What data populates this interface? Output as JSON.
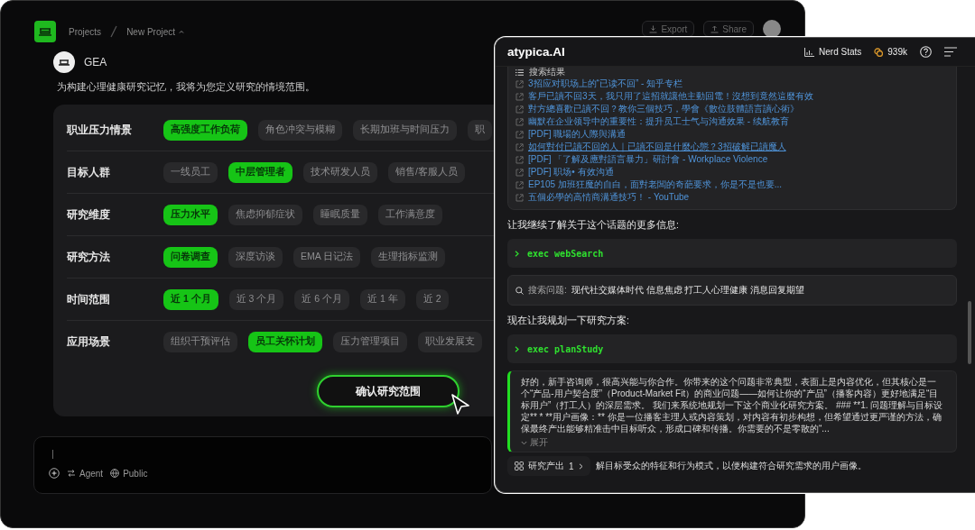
{
  "left_window": {
    "breadcrumb": [
      "Projects",
      "New Project"
    ],
    "header_buttons": [
      {
        "kind": "export",
        "label": "Export"
      },
      {
        "kind": "share",
        "label": "Share"
      }
    ],
    "assistant": {
      "name": "GEA",
      "message": "为构建心理健康研究记忆，我将为您定义研究的情境范围。"
    },
    "scope_rows": [
      {
        "label": "职业压力情景",
        "options": [
          {
            "label": "高强度工作负荷",
            "selected": true
          },
          {
            "label": "角色冲突与模糊",
            "selected": false
          },
          {
            "label": "长期加班与时间压力",
            "selected": false
          },
          {
            "label": "职",
            "selected": false
          }
        ]
      },
      {
        "label": "目标人群",
        "options": [
          {
            "label": "一线员工",
            "selected": false
          },
          {
            "label": "中层管理者",
            "selected": true
          },
          {
            "label": "技术研发人员",
            "selected": false
          },
          {
            "label": "销售/客服人员",
            "selected": false
          }
        ]
      },
      {
        "label": "研究维度",
        "options": [
          {
            "label": "压力水平",
            "selected": true
          },
          {
            "label": "焦虑抑郁症状",
            "selected": false
          },
          {
            "label": "睡眠质量",
            "selected": false
          },
          {
            "label": "工作满意度",
            "selected": false
          }
        ]
      },
      {
        "label": "研究方法",
        "options": [
          {
            "label": "问卷调查",
            "selected": true
          },
          {
            "label": "深度访谈",
            "selected": false
          },
          {
            "label": "EMA 日记法",
            "selected": false
          },
          {
            "label": "生理指标监测",
            "selected": false
          }
        ]
      },
      {
        "label": "时间范围",
        "options": [
          {
            "label": "近 1 个月",
            "selected": true
          },
          {
            "label": "近 3 个月",
            "selected": false
          },
          {
            "label": "近 6 个月",
            "selected": false
          },
          {
            "label": "近 1 年",
            "selected": false
          },
          {
            "label": "近 2",
            "selected": false
          }
        ]
      },
      {
        "label": "应用场景",
        "options": [
          {
            "label": "组织干预评估",
            "selected": false
          },
          {
            "label": "员工关怀计划",
            "selected": true
          },
          {
            "label": "压力管理项目",
            "selected": false
          },
          {
            "label": "职业发展支",
            "selected": false
          }
        ]
      }
    ],
    "confirm_button": "确认研究范围",
    "composer": {
      "tools": [
        {
          "kind": "agent",
          "label": "Agent"
        },
        {
          "kind": "public",
          "label": "Public"
        }
      ]
    }
  },
  "right_window": {
    "brand": "atypica.AI",
    "nerd_stats": "Nerd Stats",
    "credits": "939k",
    "search_results": {
      "title": "搜索结果",
      "links": [
        {
          "text": "3招应对职场上的“已读不回” - 知乎专栏",
          "hovered": false
        },
        {
          "text": "客戶已讀不回3天，我只用了這招就讓他主動回電！沒想到竟然這麼有效",
          "hovered": false
        },
        {
          "text": "對方總喜歡已讀不回？教你三個技巧，學會《數位肢體語言讀心術》",
          "hovered": false
        },
        {
          "text": "幽默在企业领导中的重要性：提升员工士气与沟通效果 - 续航教育",
          "hovered": false
        },
        {
          "text": "[PDF] 職場的人際與溝通",
          "hovered": false
        },
        {
          "text": "如何對付已讀不回的人｜已讀不回是什麼心態？3招破解已讀魔人",
          "hovered": true
        },
        {
          "text": "[PDF] 「了解及應對語言暴力」研討會 - Workplace Violence",
          "hovered": false
        },
        {
          "text": "[PDF] 职场• 有效沟通",
          "hovered": false
        },
        {
          "text": "EP105 加班狂魔的自白，面對老闆的奇葩要求，你是不是也要...",
          "hovered": false
        },
        {
          "text": "五個必學的高情商溝通技巧！ - YouTube",
          "hovered": false
        }
      ]
    },
    "feed": [
      {
        "kind": "text",
        "text": "让我继续了解关于这个话题的更多信息:"
      },
      {
        "kind": "exec",
        "text": "exec webSearch"
      },
      {
        "kind": "query",
        "label": "搜索问题:",
        "text": "现代社交媒体时代 信息焦虑 打工人心理健康 消息回复期望"
      },
      {
        "kind": "text",
        "text": "现在让我规划一下研究方案:"
      },
      {
        "kind": "exec",
        "text": "exec planStudy"
      },
      {
        "kind": "message",
        "text": "好的，新手咨询师，很高兴能与你合作。你带来的这个问题非常典型，表面上是内容优化，但其核心是一个“产品-用户契合度”（Product-Market Fit）的商业问题——如何让你的“产品”（播客内容）更好地满足“目标用户”（打工人）的深层需求。 我们来系统地规划一下这个商业化研究方案。 ### **1. 问题理解与目标设定** * **用户画像：** 你是一位播客主理人或内容策划，对内容有初步构想，但希望通过更严谨的方法，确保最终产出能够精准击中目标听众，形成口碑和传播。你需要的不是零散的“...",
        "toggle": "展开"
      }
    ],
    "output_chip": {
      "label": "研究产出",
      "count": "1"
    },
    "trailing_text": "解目标受众的特征和行为模式，以便构建符合研究需求的用户画像。"
  }
}
